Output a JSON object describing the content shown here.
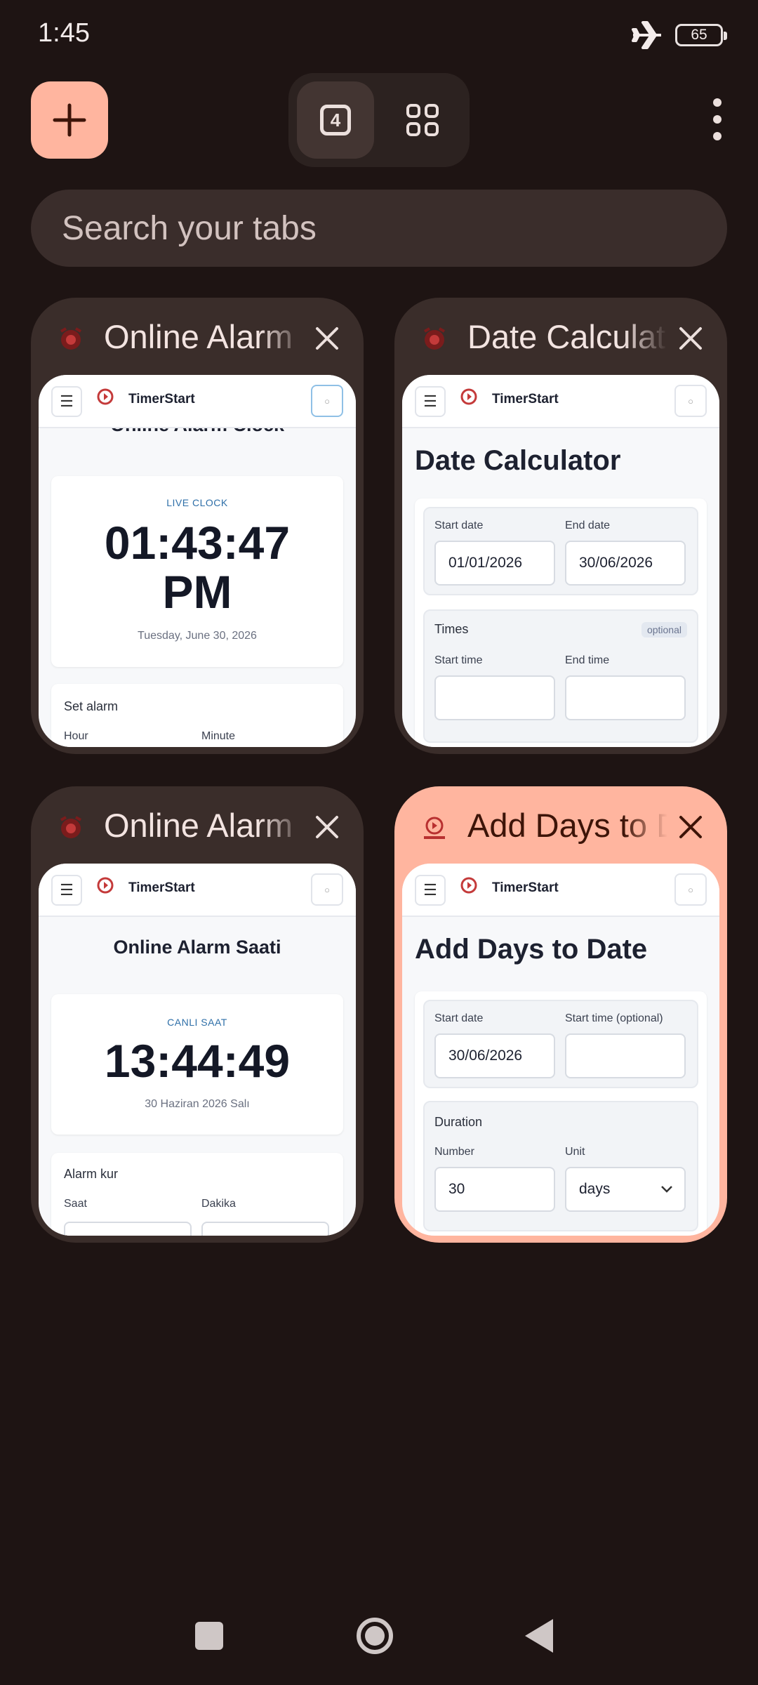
{
  "status_bar": {
    "time": "1:45",
    "battery": "65",
    "icons": [
      "airplane-mode-icon",
      "battery-icon"
    ]
  },
  "toolbar": {
    "new_tab_icon": "plus-icon",
    "tab_count": "4",
    "grid_icon": "tab-groups-grid-icon",
    "more_icon": "more-vertical-icon"
  },
  "search": {
    "placeholder": "Search your tabs"
  },
  "colors": {
    "background": "#1e1413",
    "card": "#3a2d2a",
    "accent": "#ffb59f"
  },
  "tabs": [
    {
      "title": "Online Alarm Clock",
      "selected": false,
      "page": {
        "brand": "TimerStart",
        "heading": "Online Alarm Clock",
        "live_label": "LIVE CLOCK",
        "clock_time": "01:43:47",
        "clock_ampm": "PM",
        "date": "Tuesday, June 30, 2026",
        "section": "Set alarm",
        "field1": "Hour",
        "field2": "Minute"
      }
    },
    {
      "title": "Date Calculator",
      "selected": false,
      "page": {
        "brand": "TimerStart",
        "heading": "Date Calculator",
        "start_date_label": "Start date",
        "end_date_label": "End date",
        "start_date": "01/01/2026",
        "end_date": "30/06/2026",
        "times_label": "Times",
        "optional_badge": "optional",
        "start_time_label": "Start time",
        "end_time_label": "End time"
      }
    },
    {
      "title": "Online Alarm Saati",
      "selected": false,
      "page": {
        "brand": "TimerStart",
        "heading": "Online Alarm Saati",
        "live_label": "CANLI SAAT",
        "clock_time": "13:44:49",
        "date": "30 Haziran 2026 Salı",
        "section": "Alarm kur",
        "field1": "Saat",
        "field2": "Dakika"
      }
    },
    {
      "title": "Add Days to Date",
      "selected": true,
      "page": {
        "brand": "TimerStart",
        "heading": "Add Days to Date",
        "start_date_label": "Start date",
        "start_time_label": "Start time (optional)",
        "start_date": "30/06/2026",
        "duration_label": "Duration",
        "number_label": "Number",
        "unit_label": "Unit",
        "number": "30",
        "unit": "days"
      }
    }
  ]
}
